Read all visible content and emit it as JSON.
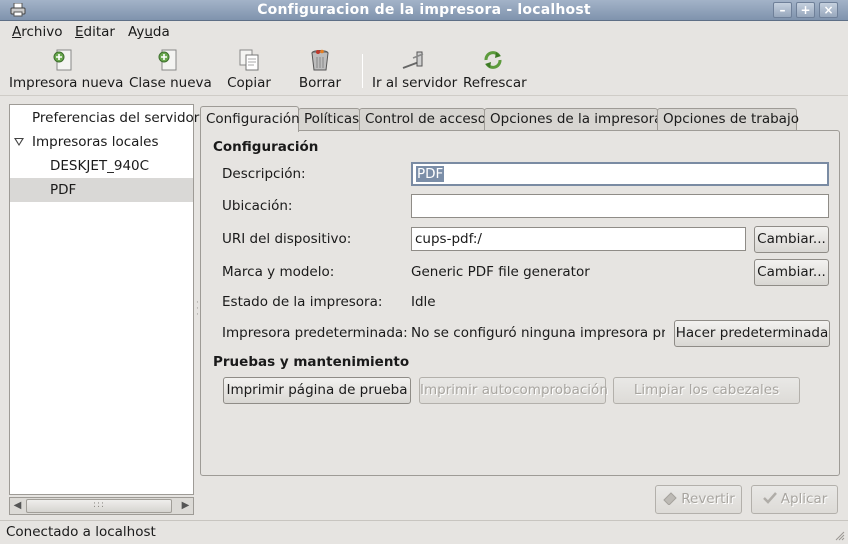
{
  "window": {
    "title": "Configuracion de la impresora - localhost",
    "controls": {
      "minimize": "–",
      "maximize": "+",
      "close": "×"
    }
  },
  "menubar": {
    "items": [
      {
        "label": "Archivo",
        "mnemonic": "A"
      },
      {
        "label": "Editar",
        "mnemonic": "E"
      },
      {
        "label": "Ayuda",
        "mnemonic": "u"
      }
    ]
  },
  "toolbar": {
    "new_printer": {
      "label": "Impresora nueva",
      "icon": "new-printer-icon"
    },
    "new_class": {
      "label": "Clase nueva",
      "icon": "new-class-icon"
    },
    "copy": {
      "label": "Copiar",
      "icon": "copy-icon"
    },
    "delete": {
      "label": "Borrar",
      "icon": "trash-icon"
    },
    "goto_server": {
      "label": "Ir al servidor",
      "icon": "server-icon"
    },
    "refresh": {
      "label": "Refrescar",
      "icon": "refresh-icon"
    }
  },
  "sidebar": {
    "items": [
      {
        "label": "Preferencias del servidor"
      },
      {
        "label": "Impresoras locales",
        "expanded": true
      },
      {
        "label": "DESKJET_940C"
      },
      {
        "label": "PDF",
        "selected": true
      }
    ],
    "scroll_grip": ":::"
  },
  "tabs": [
    {
      "label": "Configuración",
      "active": true
    },
    {
      "label": "Políticas"
    },
    {
      "label": "Control de acceso"
    },
    {
      "label": "Opciones de la impresora"
    },
    {
      "label": "Opciones de trabajo"
    }
  ],
  "config": {
    "section_title": "Configuración",
    "description_label": "Descripción:",
    "description_value": "PDF",
    "location_label": "Ubicación:",
    "location_value": "",
    "uri_label": "URI del dispositivo:",
    "uri_value": "cups-pdf:/",
    "uri_change": "Cambiar...",
    "make_label": "Marca y modelo:",
    "make_value": "Generic PDF file generator",
    "make_change": "Cambiar...",
    "state_label": "Estado de la impresora:",
    "state_value": "Idle",
    "default_label": "Impresora predeterminada:",
    "default_value": "No se configuró ninguna impresora pr...",
    "make_default": "Hacer predeterminada"
  },
  "maintenance": {
    "section_title": "Pruebas y mantenimiento",
    "print_test": "Imprimir página de prueba",
    "self_test": "Imprimir autocomprobación",
    "clean_heads": "Limpiar los cabezales"
  },
  "actions": {
    "revert": "Revertir",
    "apply": "Aplicar"
  },
  "status": {
    "text": "Conectado a localhost"
  }
}
